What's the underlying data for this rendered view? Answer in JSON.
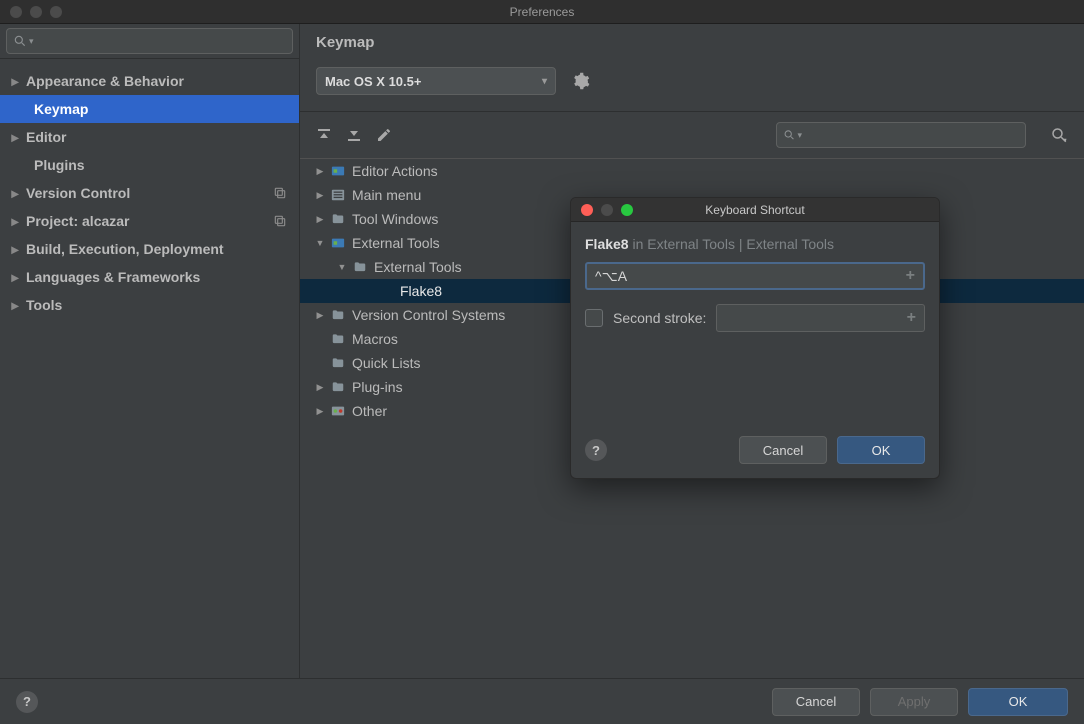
{
  "window": {
    "title": "Preferences"
  },
  "sidebar": {
    "search_placeholder": "",
    "items": [
      {
        "label": "Appearance & Behavior",
        "has_children": true
      },
      {
        "label": "Keymap",
        "has_children": false,
        "selected": true,
        "indent": true
      },
      {
        "label": "Editor",
        "has_children": true
      },
      {
        "label": "Plugins",
        "has_children": false,
        "indent": true
      },
      {
        "label": "Version Control",
        "has_children": true,
        "badge": true
      },
      {
        "label": "Project: alcazar",
        "has_children": true,
        "badge": true
      },
      {
        "label": "Build, Execution, Deployment",
        "has_children": true
      },
      {
        "label": "Languages & Frameworks",
        "has_children": true
      },
      {
        "label": "Tools",
        "has_children": true
      }
    ]
  },
  "page": {
    "title": "Keymap",
    "scheme_selected": "Mac OS X 10.5+",
    "tree": [
      {
        "label": "Editor Actions",
        "level": 0,
        "expanded": false,
        "icon": "module"
      },
      {
        "label": "Main menu",
        "level": 0,
        "expanded": false,
        "icon": "menu"
      },
      {
        "label": "Tool Windows",
        "level": 0,
        "expanded": false,
        "icon": "folder"
      },
      {
        "label": "External Tools",
        "level": 0,
        "expanded": true,
        "icon": "module"
      },
      {
        "label": "External Tools",
        "level": 1,
        "expanded": true,
        "icon": "folder"
      },
      {
        "label": "Flake8",
        "level": 2,
        "selected": true
      },
      {
        "label": "Version Control Systems",
        "level": 0,
        "expanded": false,
        "icon": "folder"
      },
      {
        "label": "Macros",
        "level": 0,
        "icon": "folder"
      },
      {
        "label": "Quick Lists",
        "level": 0,
        "icon": "folder"
      },
      {
        "label": "Plug-ins",
        "level": 0,
        "expanded": false,
        "icon": "folder"
      },
      {
        "label": "Other",
        "level": 0,
        "expanded": false,
        "icon": "module-other"
      }
    ]
  },
  "dialog": {
    "title": "Keyboard Shortcut",
    "action_name": "Flake8",
    "path_suffix": " in External Tools | External Tools",
    "shortcut_value": "^⌥A",
    "second_stroke_label": "Second stroke:",
    "buttons": {
      "cancel": "Cancel",
      "ok": "OK"
    }
  },
  "buttons": {
    "cancel": "Cancel",
    "apply": "Apply",
    "ok": "OK"
  }
}
